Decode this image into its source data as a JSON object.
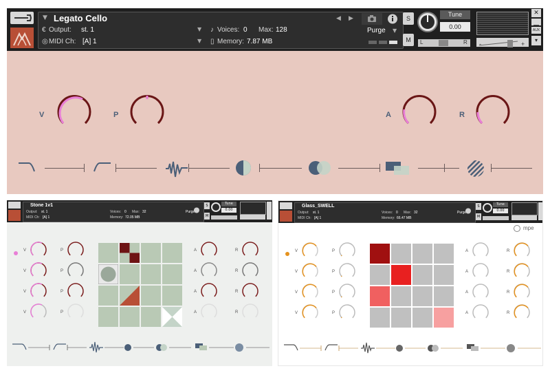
{
  "main": {
    "title": "Legato Cello",
    "output_label": "Output:",
    "output_value": "st. 1",
    "voices_label": "Voices:",
    "voices_value": "0",
    "max_label": "Max:",
    "max_value": "128",
    "purge_label": "Purge",
    "midi_label": "MIDI Ch:",
    "midi_value": "[A] 1",
    "memory_label": "Memory:",
    "memory_value": "7.87 MB",
    "solo_label": "S",
    "mute_label": "M",
    "tune_label": "Tune",
    "tune_value": "0.00",
    "pan_left": "L",
    "pan_right": "R",
    "knob_labels": [
      "V",
      "P",
      "A",
      "R"
    ],
    "knob_levels": [
      0.55,
      0.5,
      0.35,
      0.3
    ]
  },
  "stone": {
    "title": "Stone 1v1",
    "output_label": "Output:",
    "output_value": "st. 1",
    "voices_label": "Voices:",
    "voices_value": "0",
    "max_label": "Max:",
    "max_value": "32",
    "purge_label": "Purge",
    "midi_label": "MIDI Ch:",
    "midi_value": "[A] 1",
    "memory_label": "Memory:",
    "memory_value": "72.05 MB",
    "tune_label": "Tune",
    "tune_value": "0.00",
    "solo_label": "S",
    "mute_label": "M"
  },
  "glass": {
    "title": "Glass_SWELL",
    "output_label": "Output:",
    "output_value": "st. 1",
    "voices_label": "Voices:",
    "voices_value": "0",
    "max_label": "Max:",
    "max_value": "32",
    "purge_label": "Purge",
    "midi_label": "MIDI Ch:",
    "midi_value": "[A] 1",
    "memory_label": "Memory:",
    "memory_value": "66.47 MB",
    "tune_label": "Tune",
    "tune_value": "0.00",
    "solo_label": "S",
    "mute_label": "M",
    "mpe_label": "mpe"
  },
  "sub_knob_labels_left": [
    "V",
    "P"
  ],
  "sub_knob_labels_right": [
    "A",
    "R"
  ],
  "colors": {
    "main_bg": "#e8c9c0",
    "pink_arc": "#e87fd6",
    "dark_red_arc": "#7a1c1c",
    "orange_arc": "#e5921e",
    "accent_logo": "#b84f36",
    "stone_grid_cell": "#b9c9b5",
    "glass_grid_cell": "#c0c0c0"
  }
}
